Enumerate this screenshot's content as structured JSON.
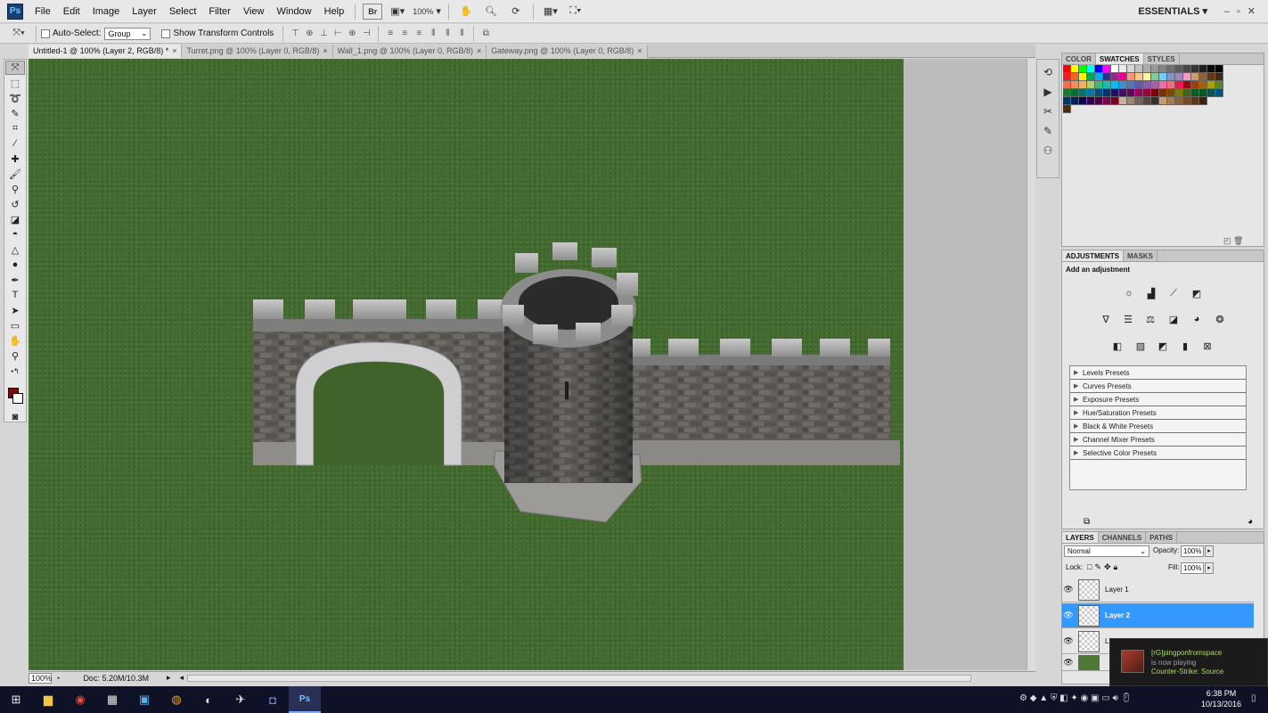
{
  "app": {
    "logo": "Ps",
    "workspace": "ESSENTIALS",
    "zoom": "100%"
  },
  "menu": [
    "File",
    "Edit",
    "Image",
    "Layer",
    "Select",
    "Filter",
    "View",
    "Window",
    "Help"
  ],
  "menubar_icons": {
    "bridge": "Br",
    "zoom_label": "100%"
  },
  "options": {
    "auto_select_label": "Auto-Select:",
    "auto_select_value": "Group",
    "show_transform_label": "Show Transform Controls"
  },
  "tabs": [
    {
      "label": "Untitled-1 @ 100% (Layer 2, RGB/8) *",
      "close": "×"
    },
    {
      "label": "Turret.png @ 100% (Layer 0, RGB/8)",
      "close": "×"
    },
    {
      "label": "Wall_1.png @ 100% (Layer 0, RGB/8)",
      "close": "×"
    },
    {
      "label": "Gateway.png @ 100% (Layer 0, RGB/8)",
      "close": "×"
    }
  ],
  "status": {
    "zoom": "100%",
    "doc": "Doc: 5.20M/10.3M"
  },
  "color_panel": {
    "tabs": [
      "COLOR",
      "SWATCHES",
      "STYLES"
    ],
    "swatches_row1": [
      "#ff0000",
      "#ffff00",
      "#00ff00",
      "#00ffff",
      "#0000ff",
      "#ff00ff",
      "#ffffff",
      "#ebebeb",
      "#d6d6d6",
      "#c2c2c2",
      "#adadad",
      "#999999",
      "#858585",
      "#707070",
      "#5c5c5c",
      "#474747",
      "#333333",
      "#1f1f1f",
      "#0a0a0a",
      "#000000"
    ],
    "swatches_row2": [
      "#ee1c24",
      "#f26522",
      "#fff200",
      "#00a651",
      "#00aeef",
      "#2e3192",
      "#92278f",
      "#ec008c",
      "#f7977a",
      "#fdc68a",
      "#fff79a",
      "#82ca9d",
      "#6dcff6",
      "#8393ca",
      "#a186be",
      "#f49ac2",
      "#c69c6d",
      "#8c6239",
      "#603913",
      "#3d2916"
    ],
    "swatches_row3": [
      "#f26c4f",
      "#f68e56",
      "#fbaf5c",
      "#acd373",
      "#3cb878",
      "#1cbbb4",
      "#00bff3",
      "#448ccb",
      "#5674b9",
      "#605ca8",
      "#855fa8",
      "#a763a8",
      "#f06eaa",
      "#f26d7d",
      "#ed145b",
      "#9e0b0f",
      "#a0410d",
      "#a3620a",
      "#aba000",
      "#598527"
    ],
    "swatches_row4": [
      "#1a7b30",
      "#007236",
      "#00746b",
      "#0076a3",
      "#004b80",
      "#003471",
      "#1b1464",
      "#440e62",
      "#630460",
      "#9e005d",
      "#9e0039",
      "#790000",
      "#7b2e00",
      "#7d4900",
      "#827b00",
      "#406618",
      "#005e20",
      "#005826",
      "#005952",
      "#00557f"
    ],
    "swatches_row5": [
      "#003663",
      "#002157",
      "#0d004c",
      "#32004b",
      "#4b0049",
      "#7b0046",
      "#7a0026",
      "#c7b299",
      "#998675",
      "#736357",
      "#534741",
      "#362f2d",
      "#c69c6d",
      "#a67c52",
      "#8c6239",
      "#754c24",
      "#603913",
      "#3c2415"
    ],
    "swatches_row6": [
      "#4a2c0f"
    ]
  },
  "adjustments": {
    "tabs": [
      "ADJUSTMENTS",
      "MASKS"
    ],
    "heading": "Add an adjustment",
    "presets": [
      "Levels Presets",
      "Curves Presets",
      "Exposure Presets",
      "Hue/Saturation Presets",
      "Black & White Presets",
      "Channel Mixer Presets",
      "Selective Color Presets"
    ]
  },
  "layers": {
    "tabs": [
      "LAYERS",
      "CHANNELS",
      "PATHS"
    ],
    "blend_mode": "Normal",
    "opacity_label": "Opacity:",
    "opacity": "100%",
    "lock_label": "Lock:",
    "fill_label": "Fill:",
    "fill": "100%",
    "rows": [
      {
        "name": "Layer 1",
        "selected": false
      },
      {
        "name": "Layer 2",
        "selected": true
      },
      {
        "name": "L",
        "selected": false
      }
    ]
  },
  "notification": {
    "user": "[rG]pingponfromspace",
    "status": "is now playing",
    "game": "Counter-Strike: Source"
  },
  "clock": {
    "time": "6:38 PM",
    "date": "10/13/2016"
  },
  "colors": {
    "canvas_green": "#446c2f",
    "selected_layer": "#3399ff",
    "foreground": "#7a0c0c"
  }
}
